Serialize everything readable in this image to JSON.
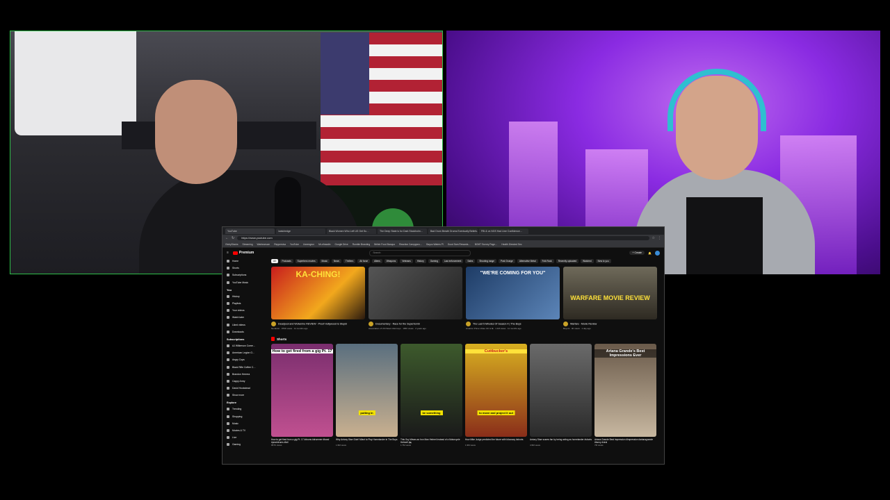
{
  "browser": {
    "tabs": [
      "YouTube",
      "/watchedge",
      "Black Women Who Left US Get Su…",
      "The Deep State is for Dark Stockholm…",
      "Bad Drum Breath Drums Eventually Beliefs…",
      "FBI & vs NGS Had Ltne Confidence…"
    ],
    "url": "https://www.youtube.com",
    "bookmarks": [
      "GlobyStocks",
      "Streaming",
      "Warbearsom",
      "Reppersiva",
      "YouTube",
      "Useengrun",
      "Mr-efrawdin",
      "Google Drive",
      "Rumble Branding",
      "British Food Banquo",
      "Reaction Campgnnc…",
      "Bayou Waters Pl",
      "Good Sam Rewards…",
      "BOMT Survey Page…",
      "Health Directed Sec"
    ]
  },
  "youtube": {
    "logo": "Premium",
    "search_placeholder": "Search",
    "create_label": "+ Create",
    "chips": [
      "All",
      "Podcasts",
      "Superhero movies",
      "Music",
      "News",
      "Thrillers",
      "Air force",
      "Aliens",
      "Weapons",
      "Veterans",
      "History",
      "Gaming",
      "Law enforcement",
      "Sales",
      "Shooting range",
      "Post Grunge",
      "Alternative Metal",
      "Folk Rock",
      "Recently uploaded",
      "Watched",
      "New to you"
    ],
    "sidebar": {
      "main": [
        "Home",
        "Shorts",
        "Subscriptions",
        "YouTube Music"
      ],
      "you_label": "You",
      "you": [
        "History",
        "Playlists",
        "Your videos",
        "Watch later",
        "Liked videos",
        "Downloads"
      ],
      "subs_label": "Subscriptions",
      "subs": [
        "AJ Wilkerson Come…",
        "American Legion G…",
        "Angry Cops",
        "Black Rifle Coffee C…",
        "Brandon Herrera",
        "Cappy Army",
        "David Hookstead",
        "Show more"
      ],
      "explore_label": "Explore",
      "explore": [
        "Trending",
        "Shopping",
        "Music",
        "Movies & TV",
        "Live",
        "Gaming"
      ]
    },
    "videos": [
      {
        "thumb_text": "KA-CHING!",
        "title": "Deadpool and Wolverine REVIEW - Proof Hollywood Is Stupid",
        "meta": "Nerdrotic · 979K views · 11 months ago"
      },
      {
        "thumb_text": "",
        "title": "Documentary - Race for the Superbomb",
        "meta": "Association of US Patent Attorneys · 195K views · 2 years ago"
      },
      {
        "thumb_text": "\"WE'RE COMING FOR YOU\"",
        "title": "The Last 5 Minutes Of Season 4 | The Boys",
        "meta": "Amazon Prime Video UK & IE · 1.1M views · 11 months ago"
      },
      {
        "thumb_text": "WARFARE MOVIE REVIEW",
        "title": "Warfare - Movie Review",
        "meta": "Beyoni · 4K views · 1 day ago"
      }
    ],
    "shorts_label": "Shorts",
    "shorts": [
      {
        "thumb_text": "How to get fired from a gig Pt. 17",
        "caption": "",
        "title": "How to get fired from a gig Pt. 17 #drums #drummer #band #pearldrums #fail",
        "meta": "957K views"
      },
      {
        "thumb_text": "",
        "caption": "putting in",
        "title": "Why Antony Starr Didn't Want to Play Homelander in The Boys",
        "meta": "1.9M views"
      },
      {
        "thumb_text": "",
        "caption": "be something",
        "title": "This Guy Wears an Iron Man Helmet Instead of a Motorcycle Helmet! 🏍",
        "meta": "1.7M views"
      },
      {
        "thumb_text": "Cuttbucker's",
        "caption": "to move and project it out",
        "title": "How Mike Judge predicted the future with Idiocracy #shorts",
        "meta": "1.9M views"
      },
      {
        "thumb_text": "",
        "caption": "",
        "title": "Antony Starr scares fan by being acting as homelander #shorts",
        "meta": "4.9M views"
      },
      {
        "thumb_text": "Ariana Grande's Best Impressions Ever",
        "caption": "",
        "title": "Ariana Grande Best Impression #impression #arianagrande #funny #viral",
        "meta": "7M views"
      }
    ]
  }
}
